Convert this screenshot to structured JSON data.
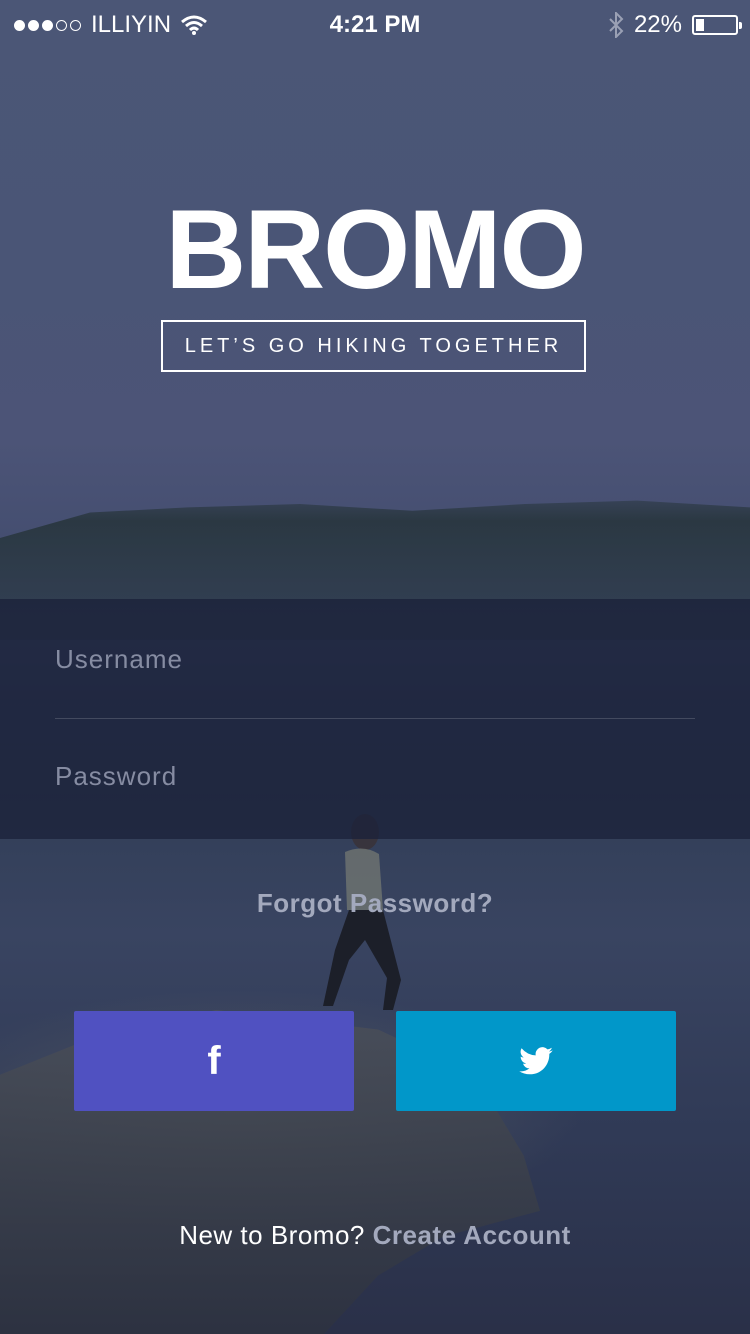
{
  "status_bar": {
    "carrier": "ILLIYIN",
    "time": "4:21 PM",
    "battery_percent": "22%",
    "battery_level": 0.22,
    "signal_bars_filled": 3,
    "signal_bars_total": 5
  },
  "brand": {
    "logo": "BROMO",
    "tagline": "LET’S GO HIKING TOGETHER"
  },
  "login": {
    "username_placeholder": "Username",
    "password_placeholder": "Password",
    "forgot_label": "Forgot Password?"
  },
  "social": {
    "facebook_icon": "facebook-icon",
    "twitter_icon": "twitter-icon",
    "facebook_color": "#5051c1",
    "twitter_color": "#0197c9"
  },
  "signup": {
    "prompt": "New to Bromo?",
    "link": "Create Account"
  }
}
